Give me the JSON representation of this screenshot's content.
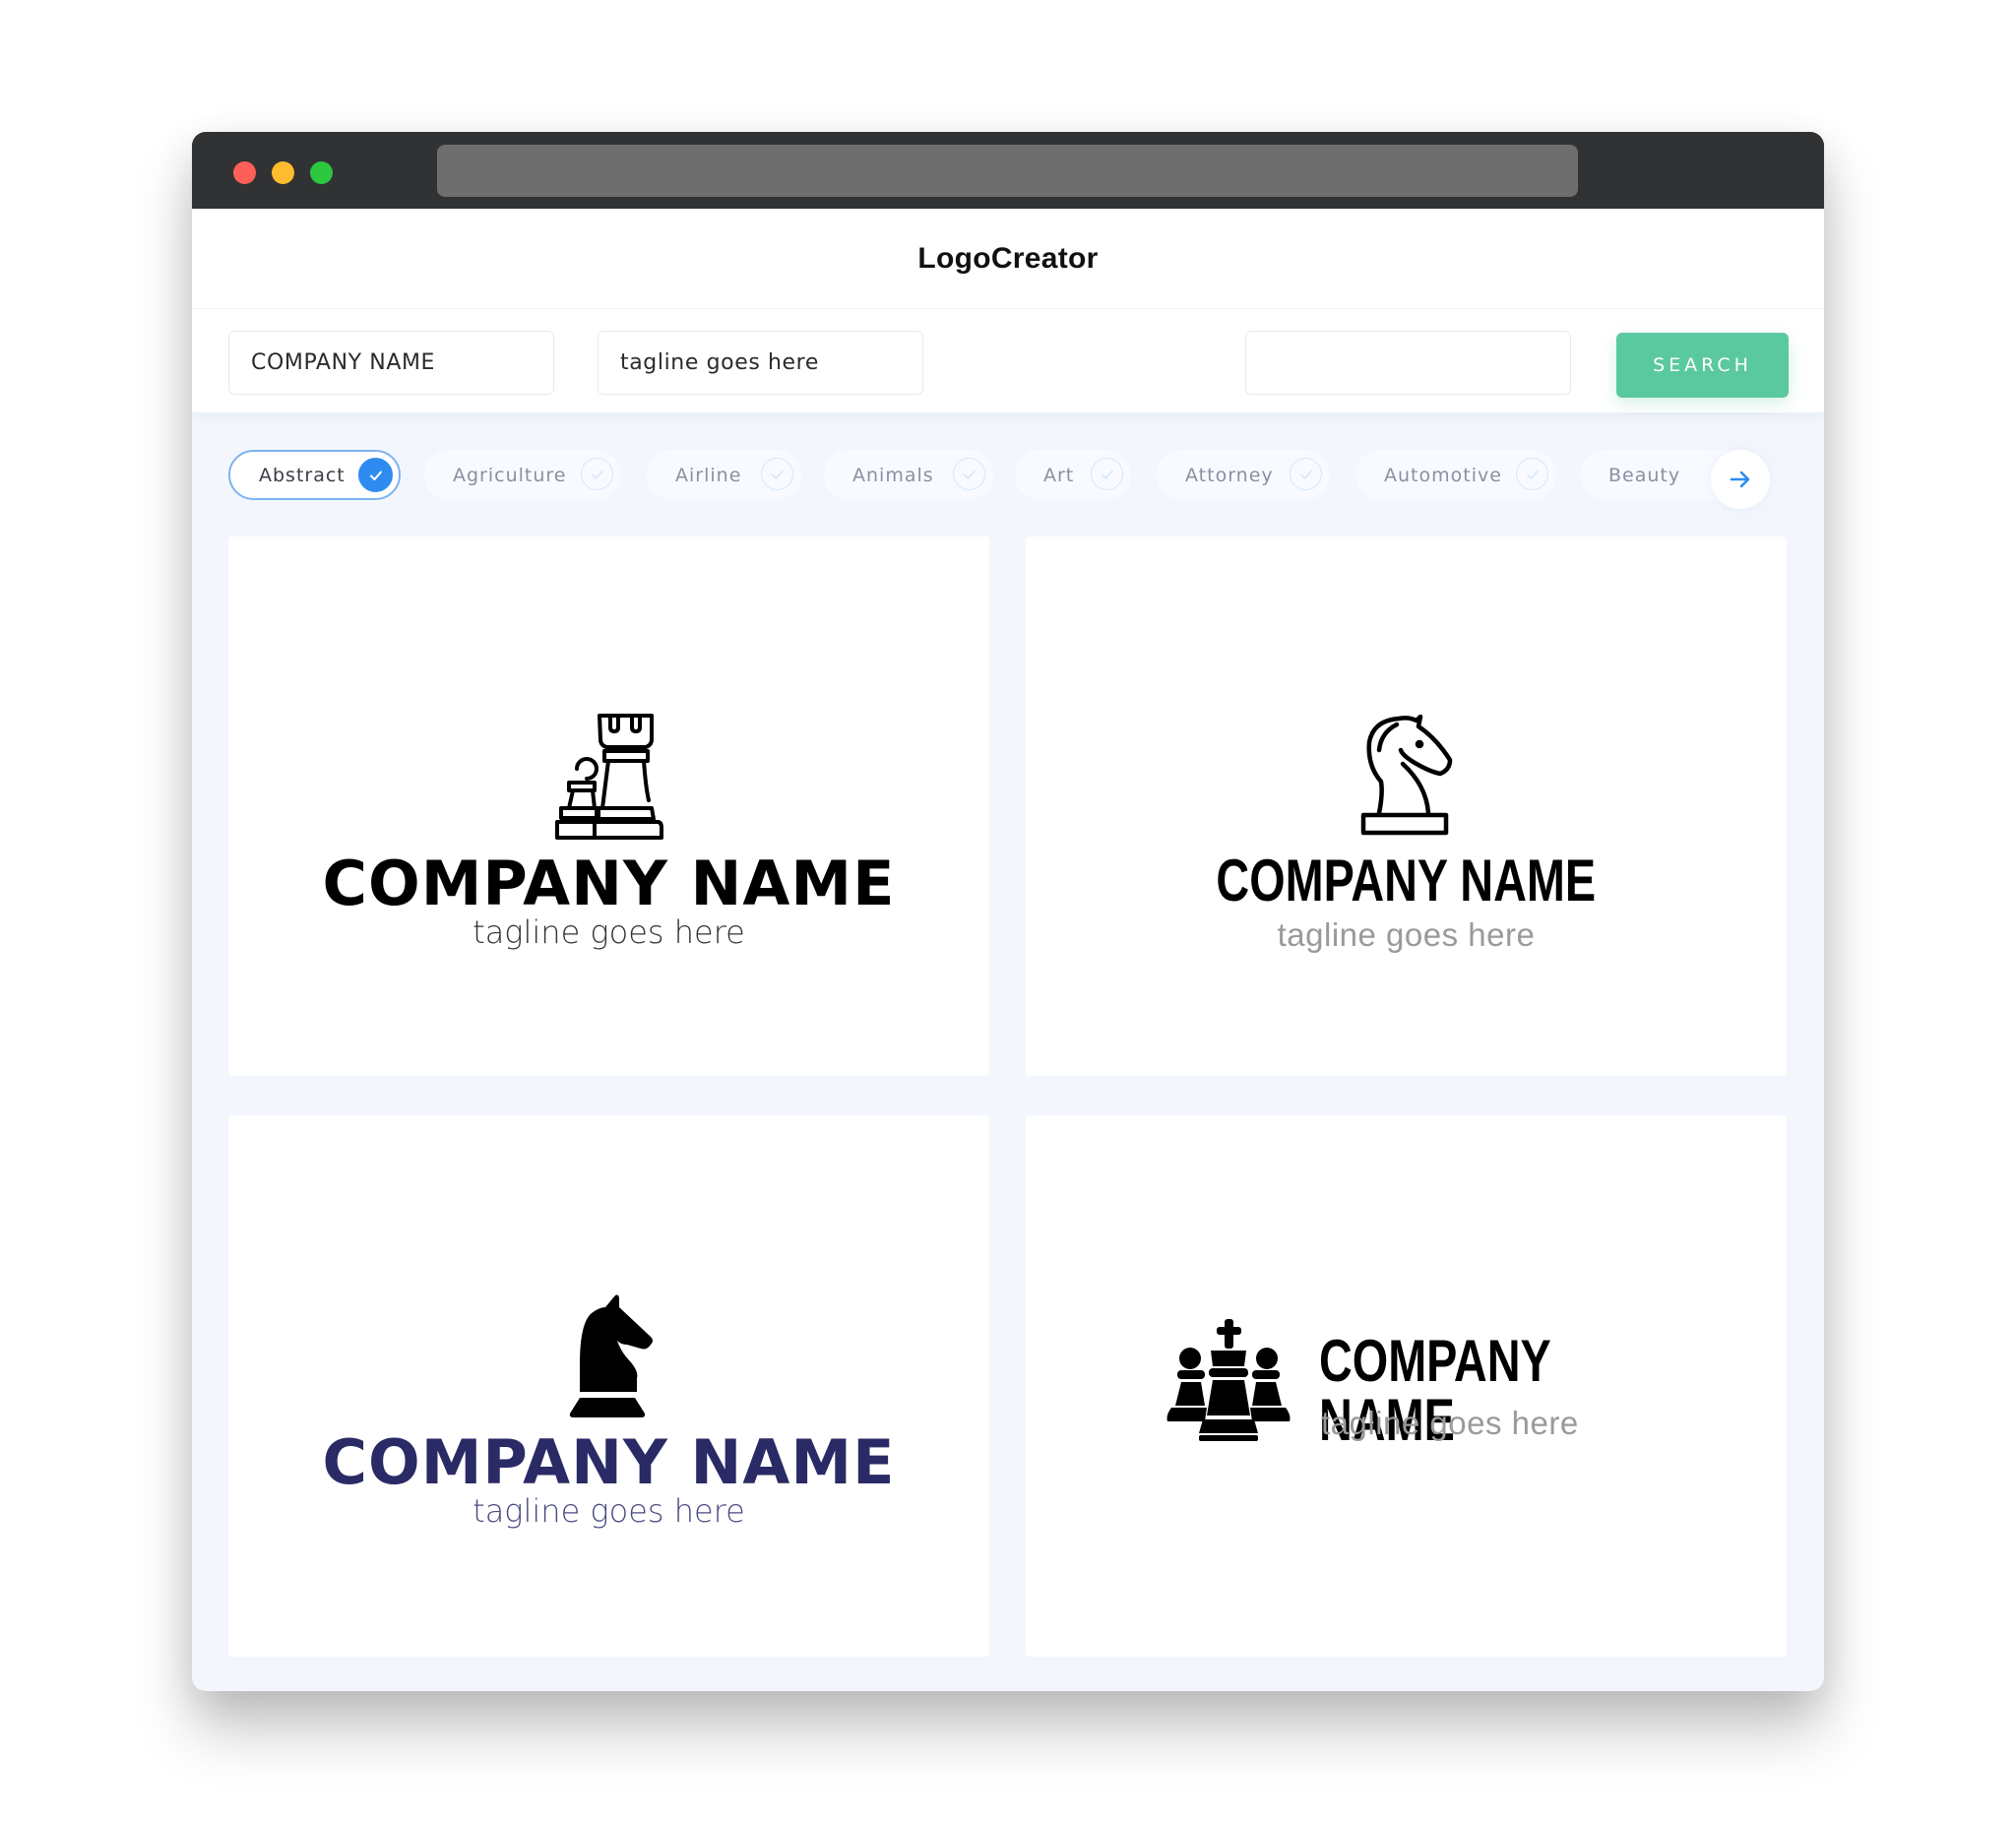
{
  "app": {
    "brand": "LogoCreator",
    "window_controls": [
      "close",
      "minimize",
      "maximize"
    ]
  },
  "search": {
    "company_name_value": "COMPANY NAME",
    "tagline_value": "tagline goes here",
    "keyword_value": "",
    "button_label": "SEARCH"
  },
  "categories": {
    "items": [
      {
        "label": "Abstract",
        "selected": true
      },
      {
        "label": "Agriculture",
        "selected": false
      },
      {
        "label": "Airline",
        "selected": false
      },
      {
        "label": "Animals",
        "selected": false
      },
      {
        "label": "Art",
        "selected": false
      },
      {
        "label": "Attorney",
        "selected": false
      },
      {
        "label": "Automotive",
        "selected": false
      },
      {
        "label": "Beauty",
        "selected": false
      }
    ],
    "next_icon": "arrow-right-icon"
  },
  "colors": {
    "accent_green": "#5bc9a0",
    "selected_blue": "#2e8cf0",
    "navy_text": "#2a2a66",
    "titlebar": "#313234"
  },
  "logos": [
    {
      "icon": "chess-rook-pawn-outline-icon",
      "company": "COMPANY NAME",
      "tagline": "tagline goes here"
    },
    {
      "icon": "chess-knight-outline-icon",
      "company": "COMPANY NAME",
      "tagline": "tagline goes here"
    },
    {
      "icon": "chess-knight-solid-icon",
      "company": "COMPANY NAME",
      "tagline": "tagline goes here"
    },
    {
      "icon": "chess-king-pawns-solid-icon",
      "company": "COMPANY NAME",
      "tagline": "tagline goes here"
    }
  ]
}
